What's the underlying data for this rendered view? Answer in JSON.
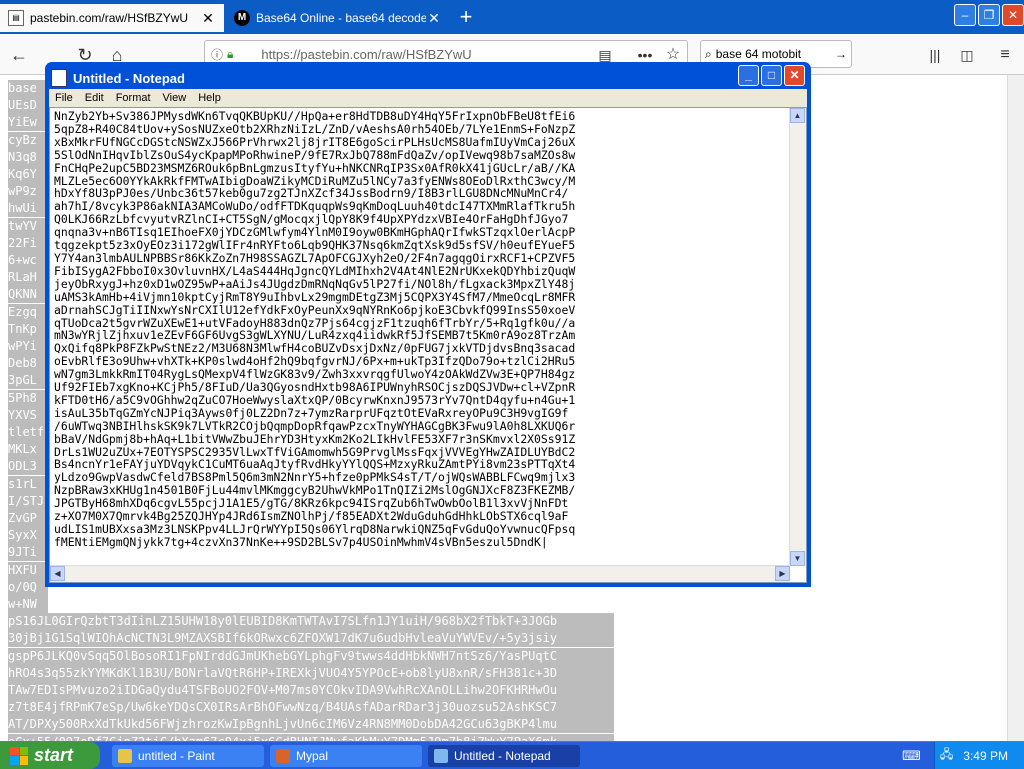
{
  "browser": {
    "tabs": [
      {
        "label": "pastebin.com/raw/HSfBZYwU",
        "active": true
      },
      {
        "label": "Base64 Online - base64 decode a",
        "active": false
      }
    ],
    "url": "https://pastebin.com/raw/HSfBZYwU",
    "search_value": "base 64 motobit"
  },
  "page": {
    "visible_lines": [
      "base",
      "UEsD",
      "YiEw",
      "cyBz",
      "N3q8",
      "Kq6Y",
      "wP9z",
      "hwUi",
      "twYV",
      "22Fi",
      "6+wc",
      "RLaH",
      "QKNN",
      "Ezgq",
      "TnKp",
      "wPYi",
      "Deb8",
      "3pGL",
      "5Ph8",
      "YXVS",
      "tletf",
      "MKLx",
      "ODL3",
      "s1rL",
      "I/STJ",
      "ZvGP",
      "SyxX",
      "9JTi",
      "HXFU",
      "o/0Q",
      "w+NW",
      "pS16JL0GIrQzbtT3dIinLZ15UHW18y0lEUBID8KmTWTAvI7SLfn1JY1uiH/968bX2fTbkT+3JOGb",
      "30jBj1G1SqlWIOhAcNCTN3L9MZAXSBIf6kORwxc6ZFOXW17dK7u6udbHvleaVuYWVEv/+5y3jsiy",
      "gspP6JLKQ0vSqq5OlBosoRI1FpNIrddGJmUKhebGYLphgFv9twws4ddHbkNWH7ntSz6/YasPUqtC",
      "hRO4s3q55zkYYMKdKl1B3U/BONrlaVQtR6HP+IREXkjVUO4Y5YPOcE+ob8lyU8xnR/sFH381c+3D",
      "TAw7EDIsPMvuzo2iIDGaQydu4TSFBoUO2FOV+M07ms0YCOkvIDA9VwhRcXAnOLLihw2OFKHRHwOu",
      "z7t8E4jfRPmK7eSp/Uw6keYDQsCX0IRsArBhOFwwNzq/B4UAsfADarRDar3j30uozsu52AshKSC7",
      "AT/DPXy500RxXdTkUkd56FWjzhrozKwIpBgnhLjvUn6cIM6Vz4RN8MM0DobDA42GCu63gBKP4lmu",
      "oGx+55/097oDf7GjnZ2tjC/bXzm67c94xj5x6CdBHNIJMyfaKhMuY7DMm5J9m7h8j7WvY7PaX6mk",
      "3MQ8lZfod7EK+X+dKFZF63SvXL5vY/n0BjLcSamgqdEHyEIpsy043ru5DOAojSOAA1FCZnWraGLU"
    ]
  },
  "notepad": {
    "title": "Untitled - Notepad",
    "menus": [
      "File",
      "Edit",
      "Format",
      "View",
      "Help"
    ],
    "content": "NnZyb2Yb+Sv386JPMysdWKn6TvqQKBUpKU//HpQa+er8HdTDB8uDY4HqY5FrIxpnObFBeU8tfEi6\n5qpZ8+R40C84tUov+ySosNUZxeOtb2XRhzNiIzL/ZnD/vAeshsA0rh54OEb/7LYe1EnmS+FoNzpZ\nxBxMkrFUfNGCcDGStcNSWZxJ566PrVhrwx2lj8jrIT8E6goScirPLHsUcMS8UafmIUyVmCaj26uX\n5SlOdNnIHqvIblZsOuS4ycKpapMPoRhwineP/9fE7RxJbQ788mFdQaZv/opIVewq98b7saMZOs8w\nFnCHqPe2upC5BD23MSMZ6ROuk6pBnLgmzusItyfYu+hNKCNRqIP3Sx0AfR0kX41jGUcLr/aB//KA\nMLZLe5ec6O0YYkAkRkfFMTwAIbigDoaWZikyMCDiRuMZu5lNCy7a3fyENWs8OEoDlRxthC3wcy/M\nhDxYf8U3pPJ0es/Unbc36t57keb0gu7zg2TJnXZcf34JssBodrn9/I8B3rlLGU8DNcMNuMnCr4/\nah7hI/8vcyk3P86akNIA3AMCoWuDo/odfFTDKquqpWs9qKmDoqLuuh40tdcI47TXMmRlafTkru5h\nQ0LKJ66RzLbfcvyutvRZlnCI+CT5SgN/gMocqxjlQpY8K9f4UpXPYdzxVBIe4OrFaHgDhfJGyo7\nqnqna3v+nB6TIsq1EIhoeFX0jYDCzGMlwfym4YlnM0I9oyw0BKmHGphAQrIfwkSTzqxlOerlAcpP\ntqgzekpt5z3xOyEOz3i172gWlIFr4nRYFto6Lqb9QHK37Nsq6kmZqtXsk9d5sfSV/h0eufEYueF5\nY7Y4an3lmbAULNPBBSr86KkZoZn7H98SSAGZL7ApOFCGJXyh2eO/2F4n7agqgOirxRCF1+CPZVF5\nFibISygA2FbboI0x3OvluvnHX/L4aS444HqJgncQYLdMIhxh2V4At4NlE2NrUKxekQDYhbizQuqW\njeyObRxygJ+hz0xD1wOZ95wP+aAiJs4JUgdzDmRNqNqGv5lP27fi/NOl8h/fLgxack3MpxZlY48j\nuAMS3kAmHb+4iVjmn10kptCyjRmT8Y9uIhbvLx29mgmDEtgZ3Mj5CQPX3Y4SfM7/MmeOcqLr8MFR\naDrnahSCJgTiIINxwYsNrCXIlU12efYdkFxOyPeunXx9qNYRnKo6pjkoE3CbvkfQ99InsS50xoeV\nqTUoDca2t5gvrWZuXEwE1+utVFadoyH883dnQz7Pjs64cgjzF1tzuqh6fTrbYr/5+Rq1gfk0u//a\nmN3wYRjlZjhxuv1eZEvF6GF6UvgS3gWLXYNU/LuR4zxq4iidwkRf5JfSEMB7t5Km0rA9oz8TrzAm\nQxQifq8PkP8FZkPwStNEz2/M3U68N3MlwfH4coBUZvDsxjDxNz/0pFUG7jxkVTDjdvsBnq3sacad\noEvbRlfE3o9Uhw+vhXTk+KP0slwd4oHf2hQ9bqfgvrNJ/6Px+m+ukTp3IfzQDo79o+tzlCi2HRu5\nwN7gm3LmkkRmIT04RygLsQMexpV4flWzGK83v9/Zwh3xxvrqgfUlwoY4zOAkWdZVw3E+QP7H84gz\nUf92FIEb7xgKno+KCjPh5/8FIuD/Ua3QGyosndHxtb98A6IPUWnyhRSOCjszDQSJVDw+cl+VZpnR\nkFTD0tH6/a5C9vOGhhw2qZuCO7HoeWwyslaXtxQP/0BcyrwKnxnJ9573rYv7QntD4qyfu+n4Gu+1\nisAuL35bTqGZmYcNJPiq3Ayws0fj0LZ2Dn7z+7ymzRarprUFqztOtEVaRxreyOPu9C3H9vgIG9f\n/6uWTwq3NBIHlhskSK9k7LVTkR2COjbQqmpDopRfqawPzcxTnyWYHAGCgBK3Fwu9lA0h8LXKUQ6r\nbBaV/NdGpmj8b+hAq+L1bitVWwZbuJEhrYD3HtyxKm2Ko2LIkHvlFE53XF7r3nSKmvxl2X0Ss91Z\nDrLs1WU2uZUx+7EOTYSPSC2935VlLwxTfViGAmomwh5G9PrvglMssFqxjVVVEgYHwZAIDLUYBdC2\nBs4ncnYr1eFAYjuYDVqykC1CuMT6uaAqJtyfRvdHkyYYlQQS+MzxyRkuZAmtPYi8vm23sPTTqXt4\nyLdzo9GwpVasdwCfeld7BS8Pml5Q6m3mN2NnrY5+hfze0pPMkS4sT/T/ojWQsWABBLFCwq9mjlx3\nNzpBRaw3xKHUg1n4501B0FjLu44mvlMKmggcyB2UhwVkMPo1TnQIZi2MslOgGNJXcF8Z3FKEZMB/\nJPGTByH68mhXDq6cgvL55pcjJ1A1E5/gTG/8KRz6kpc94ISrqZub6hTwOwbOolB1l3xvVjNnFDt\nz+XO7M0X7Qmrvk4Bg25ZQJHYp4JRd6IsmZNOlhPj/f85EADXt2WduGduhGdHhkLObSTX6cql9aF\nudLIS1mUBXxsa3Mz3LNSKPpv4LLJrQrWYYpI5Qs06YlrqD8NarwkiQNZ5qFvGduQoYvwnucQFpsq\nfMENtiEMgmQNjykk7tg+4czvXn37NnKe++9SD2BLSv7p4USOinMwhmV4sVBn5eszul5DndK|"
  },
  "taskbar": {
    "start_label": "start",
    "items": [
      {
        "label": "untitled - Paint",
        "active": false,
        "icon_color": "#e8c34a"
      },
      {
        "label": "Mypal",
        "active": false,
        "icon_color": "#d8632b"
      },
      {
        "label": "Untitled - Notepad",
        "active": true,
        "icon_color": "#7fb7ef"
      }
    ],
    "clock": "3:49 PM"
  }
}
